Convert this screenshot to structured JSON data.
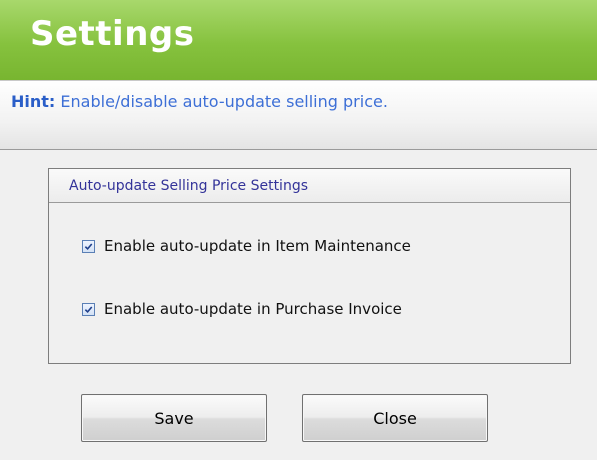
{
  "window": {
    "title": "Settings"
  },
  "hint": {
    "label": "Hint:",
    "text": "Enable/disable auto-update selling price."
  },
  "group": {
    "title": "Auto-update Selling Price Settings",
    "options": [
      {
        "label": "Enable auto-update in Item Maintenance",
        "checked": true
      },
      {
        "label": "Enable auto-update in Purchase Invoice",
        "checked": true
      }
    ]
  },
  "buttons": {
    "save": "Save",
    "close": "Close"
  },
  "colors": {
    "header_green": "#86c23e",
    "hint_blue": "#3d6fd6",
    "background": "#f0f0f0"
  }
}
